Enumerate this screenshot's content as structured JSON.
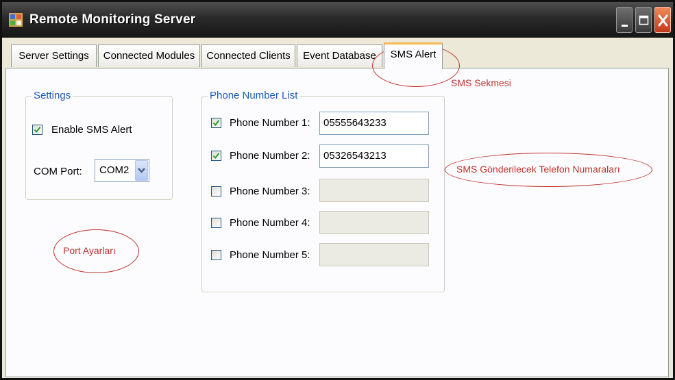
{
  "window": {
    "title": "Remote Monitoring Server"
  },
  "tabs": [
    {
      "label": "Server Settings"
    },
    {
      "label": "Connected Modules"
    },
    {
      "label": "Connected Clients"
    },
    {
      "label": "Event Database"
    },
    {
      "label": "SMS Alert",
      "active": true
    }
  ],
  "settings_group": {
    "title": "Settings",
    "enable_sms_label": "Enable SMS Alert",
    "enable_sms_checked": true,
    "com_port_label": "COM Port:",
    "com_port_value": "COM2"
  },
  "phone_group": {
    "title": "Phone Number List",
    "rows": [
      {
        "label": "Phone Number 1:",
        "value": "05555643233",
        "checked": true,
        "enabled": true
      },
      {
        "label": "Phone Number 2:",
        "value": "05326543213",
        "checked": true,
        "enabled": true
      },
      {
        "label": "Phone Number 3:",
        "value": "",
        "checked": false,
        "enabled": false
      },
      {
        "label": "Phone Number 4:",
        "value": "",
        "checked": false,
        "enabled": false
      },
      {
        "label": "Phone Number 5:",
        "value": "",
        "checked": false,
        "enabled": false
      }
    ]
  },
  "annotations": {
    "sms_tab": "SMS Sekmesi",
    "phone_numbers": "SMS Gönderilecek Telefon Numaraları",
    "port_settings": "Port Ayarları"
  },
  "colors": {
    "group_title": "#1d5bb9",
    "active_tab_accent": "#f5b94f",
    "annotation": "#c0312b",
    "close_button": "#c3371c"
  },
  "icons": {
    "app": "app-icon",
    "minimize": "minimize-icon",
    "maximize": "maximize-icon",
    "close": "close-icon",
    "dropdown": "chevron-down-icon",
    "check": "checkmark-icon"
  }
}
